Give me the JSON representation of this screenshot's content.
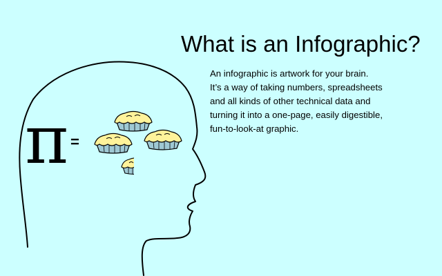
{
  "title": "What is an Infographic?",
  "description_lines": [
    "An infographic is artwork for your brain.",
    "It’s a way of taking numbers, spreadsheets",
    "and all kinds of other technical data and",
    "turning it into a one-page, easily digestible,",
    "fun-to-look-at graphic."
  ],
  "equation": {
    "pi": "π",
    "equals": "="
  },
  "colors": {
    "background": "#ccffff",
    "pie_crust": "#fff39a",
    "pie_tin": "#9fc9d4",
    "outline": "#000000"
  }
}
